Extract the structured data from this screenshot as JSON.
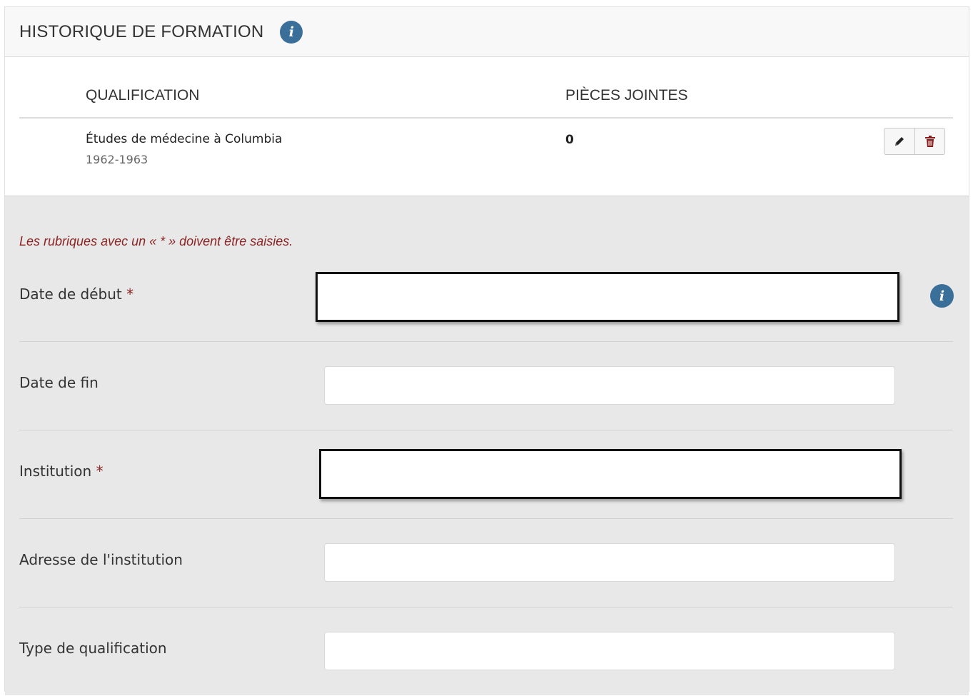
{
  "header": {
    "title": "HISTORIQUE DE FORMATION",
    "info_icon": "info-icon"
  },
  "table": {
    "columns": [
      "QUALIFICATION",
      "PIÈCES JOINTES"
    ],
    "rows": [
      {
        "qualification": "Études de médecine à Columbia",
        "years": "1962-1963",
        "attachments": "0"
      }
    ],
    "actions": [
      "edit-icon",
      "trash-icon"
    ]
  },
  "form": {
    "required_note": "Les rubriques avec un « * » doivent être saisies.",
    "fields": [
      {
        "label": "Date de début",
        "required": "*",
        "value": ""
      },
      {
        "label": "Date de fin",
        "required": "",
        "value": ""
      },
      {
        "label": "Institution",
        "required": "*",
        "value": ""
      },
      {
        "label": "Adresse de l'institution",
        "required": "",
        "value": ""
      },
      {
        "label": "Type de qualification",
        "required": "",
        "value": ""
      }
    ]
  },
  "colors": {
    "accent": "#3a6f9a",
    "required": "#8b2323",
    "form_bg": "#e8e8e8"
  }
}
